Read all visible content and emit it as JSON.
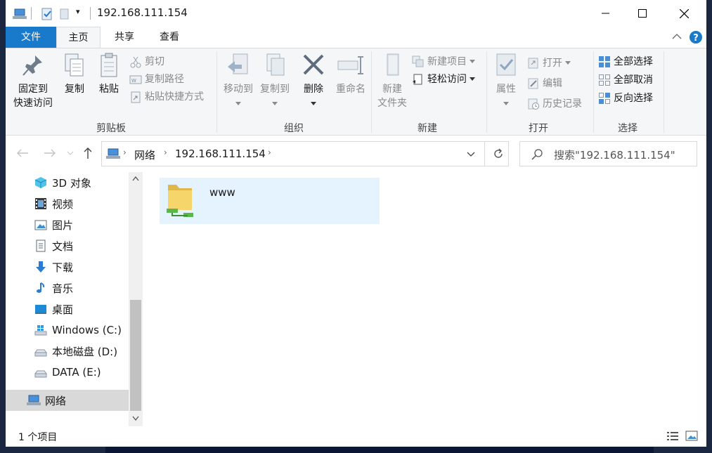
{
  "window": {
    "title": "192.168.111.154",
    "qat_dropdown": "▾"
  },
  "tabs": [
    {
      "label": "文件",
      "active": false
    },
    {
      "label": "主页",
      "active": true
    },
    {
      "label": "共享",
      "active": false
    },
    {
      "label": "查看",
      "active": false
    }
  ],
  "ribbon": {
    "clipboard": {
      "group_label": "剪贴板",
      "pin_line1": "固定到",
      "pin_line2": "快速访问",
      "copy": "复制",
      "paste": "粘贴",
      "cut": "剪切",
      "copy_path": "复制路径",
      "paste_shortcut": "粘贴快捷方式"
    },
    "organize": {
      "group_label": "组织",
      "move_to": "移动到",
      "copy_to": "复制到",
      "delete": "删除",
      "rename": "重命名"
    },
    "new": {
      "group_label": "新建",
      "new_folder_line1": "新建",
      "new_folder_line2": "文件夹",
      "new_item": "新建项目",
      "easy_access": "轻松访问"
    },
    "open": {
      "group_label": "打开",
      "properties": "属性",
      "open": "打开",
      "edit": "编辑",
      "history": "历史记录"
    },
    "select": {
      "group_label": "选择",
      "select_all": "全部选择",
      "select_none": "全部取消",
      "invert": "反向选择"
    }
  },
  "address": {
    "crumbs": [
      "网络",
      "192.168.111.154"
    ],
    "search_placeholder": "搜索\"192.168.111.154\""
  },
  "nav_items": [
    {
      "label": "3D 对象",
      "icon": "3d-objects-icon"
    },
    {
      "label": "视频",
      "icon": "video-icon"
    },
    {
      "label": "图片",
      "icon": "pictures-icon"
    },
    {
      "label": "文档",
      "icon": "documents-icon"
    },
    {
      "label": "下载",
      "icon": "download-icon"
    },
    {
      "label": "音乐",
      "icon": "music-icon"
    },
    {
      "label": "桌面",
      "icon": "desktop-icon"
    },
    {
      "label": "Windows (C:)",
      "icon": "windows-drive-icon"
    },
    {
      "label": "本地磁盘 (D:)",
      "icon": "drive-icon"
    },
    {
      "label": "DATA (E:)",
      "icon": "drive-icon"
    },
    {
      "label": "网络",
      "icon": "network-icon",
      "selected": true
    }
  ],
  "items": [
    {
      "name": "www",
      "icon": "shared-folder-icon"
    }
  ],
  "status": {
    "count": "1 个项目"
  },
  "colors": {
    "accent": "#1979ca",
    "selection": "#e5f3ff",
    "ribbon_bg": "#f5f6f7"
  }
}
